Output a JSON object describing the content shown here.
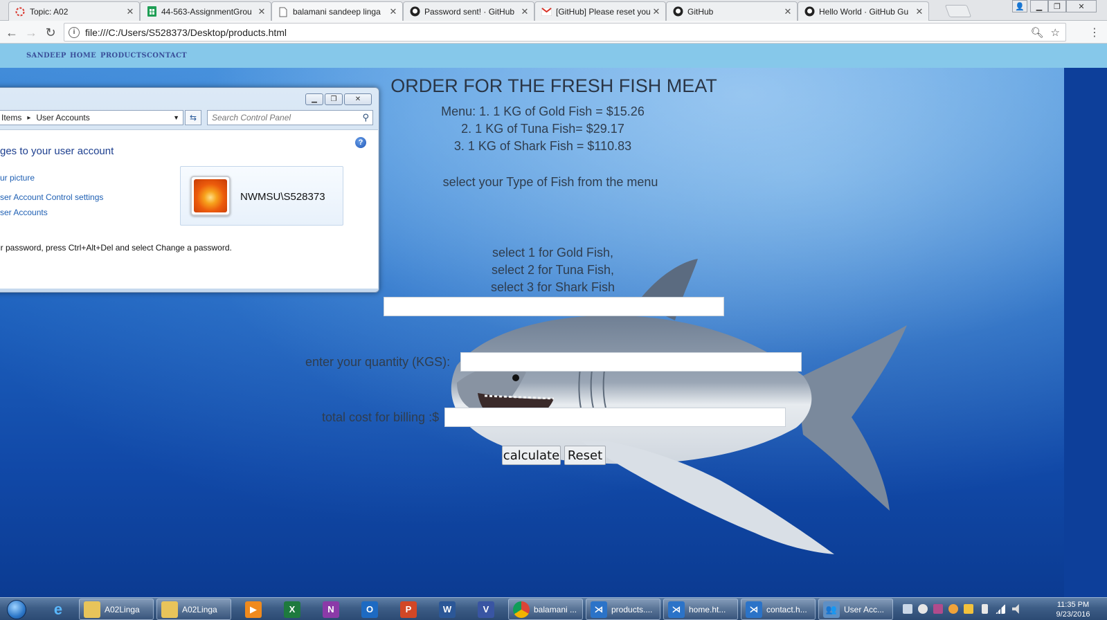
{
  "browser": {
    "tabs": [
      {
        "title": "Topic: A02",
        "icon": "generic-topic-icon"
      },
      {
        "title": "44-563-AssignmentGrou",
        "icon": "sheets-icon"
      },
      {
        "title": "balamani sandeep linga",
        "icon": "page-icon"
      },
      {
        "title": "Password sent! · GitHub",
        "icon": "github-icon"
      },
      {
        "title": "[GitHub] Please reset you",
        "icon": "gmail-icon"
      },
      {
        "title": "GitHub",
        "icon": "github-icon"
      },
      {
        "title": "Hello World · GitHub Gu",
        "icon": "github-icon"
      }
    ],
    "active_tab": 2,
    "url": "file:///C:/Users/S528373/Desktop/products.html"
  },
  "site": {
    "nav": [
      "SANDEEP",
      "HOME",
      "PRODUCTS",
      "CONTACT"
    ],
    "heading": "ORDER FOR THE FRESH FISH MEAT",
    "menu_lines": [
      "Menu: 1. 1 KG of Gold Fish = $15.26",
      "2. 1 KG of Tuna Fish= $29.17",
      "3. 1 KG of Shark Fish = $110.83"
    ],
    "select_prompt": "select your Type of Fish from the menu",
    "select_options": [
      "select 1 for Gold Fish,",
      "select 2 for Tuna Fish,",
      "select 3 for Shark Fish"
    ],
    "quantity_label": "enter your quantity (KGS):",
    "total_label": "total cost for billing :$",
    "fish_type_value": "",
    "quantity_value": "",
    "total_value": "",
    "calculate_label": "calculate",
    "reset_label": "Reset"
  },
  "control_panel": {
    "breadcrumb": [
      "Items",
      "User Accounts"
    ],
    "search_placeholder": "Search Control Panel",
    "title": "ges to your user account",
    "links": [
      "ur picture",
      "ser Account Control settings",
      "ser Accounts"
    ],
    "username": "NWMSU\\S528373",
    "password_note": "ur password, press Ctrl+Alt+Del and select Change a password."
  },
  "taskbar": {
    "pinned": [
      {
        "label": "A02Linga",
        "icon": "folder-icon"
      },
      {
        "label": "A02Linga",
        "icon": "folder-icon"
      },
      {
        "label": "balamani ...",
        "icon": "chrome-icon"
      },
      {
        "label": "products....",
        "icon": "vscode-icon"
      },
      {
        "label": "home.ht...",
        "icon": "vscode-icon"
      },
      {
        "label": "contact.h...",
        "icon": "vscode-icon"
      },
      {
        "label": "User Acc...",
        "icon": "user-accounts-icon"
      }
    ],
    "clock_time": "11:35 PM",
    "clock_date": "9/23/2016"
  },
  "colors": {
    "navbar": "#86c8ea",
    "nav_text": "#3a4f9a",
    "page_text": "#2f3d4e",
    "ocean_dark": "#0b3b92"
  }
}
